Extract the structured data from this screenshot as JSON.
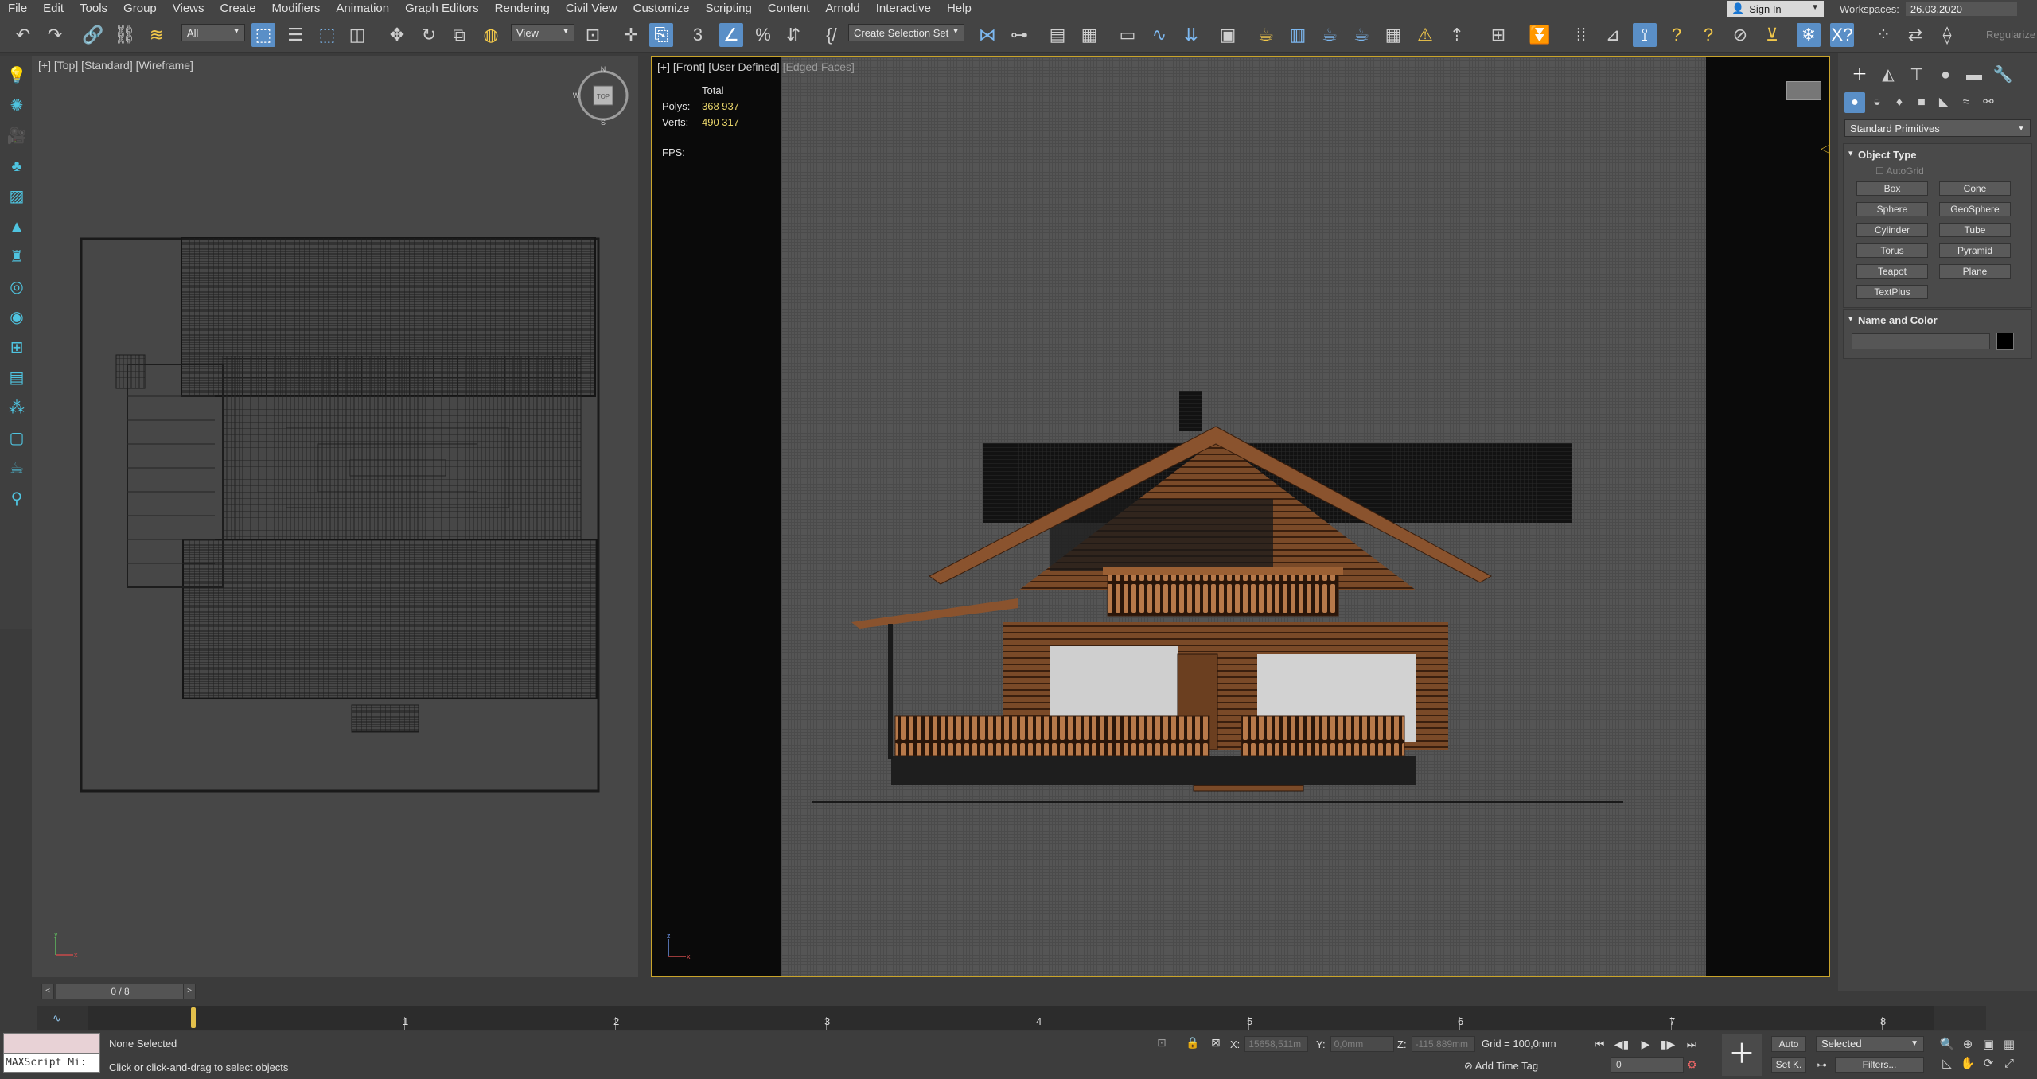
{
  "menu": [
    "File",
    "Edit",
    "Tools",
    "Group",
    "Views",
    "Create",
    "Modifiers",
    "Animation",
    "Graph Editors",
    "Rendering",
    "Civil View",
    "Customize",
    "Scripting",
    "Content",
    "Arnold",
    "Interactive",
    "Help"
  ],
  "account": {
    "sign_in": "Sign In",
    "workspaces_label": "Workspaces:",
    "workspace_value": "26.03.2020"
  },
  "toolbar": {
    "filter_value": "All",
    "ref_coord_value": "View",
    "selection_set_placeholder": "Create Selection Set",
    "regularize": "Regularize"
  },
  "viewports": {
    "top": {
      "label_plus": "[+]",
      "label_view": "[Top]",
      "label_standard": "[Standard]",
      "label_shading": "[Wireframe]",
      "viewcube_face": "TOP",
      "compass_n": "N",
      "compass_s": "S",
      "compass_w": "W",
      "axis_y": "y",
      "axis_x": "x"
    },
    "front": {
      "label_plus": "[+]",
      "label_view": "[Front]",
      "label_standard": "[User Defined]",
      "label_shading": "[Edged Faces]",
      "axis_z": "z",
      "axis_x": "x"
    }
  },
  "stats": {
    "header": "Total",
    "polys_label": "Polys:",
    "polys_value": "368 937",
    "verts_label": "Verts:",
    "verts_value": "490 317",
    "fps_label": "FPS:"
  },
  "command_panel": {
    "category": "Standard Primitives",
    "object_type_title": "Object Type",
    "autogrid": "AutoGrid",
    "objects": [
      "Box",
      "Cone",
      "Sphere",
      "GeoSphere",
      "Cylinder",
      "Tube",
      "Torus",
      "Pyramid",
      "Teapot",
      "Plane",
      "TextPlus"
    ],
    "name_color_title": "Name and Color",
    "color": "#000000"
  },
  "timeline": {
    "slider": "0 / 8",
    "prev": "<",
    "next": ">",
    "ticks": [
      "1",
      "2",
      "3",
      "4",
      "5",
      "6",
      "7",
      "8"
    ]
  },
  "status": {
    "maxscript": "MAXScript Mi:",
    "selection": "None Selected",
    "hint": "Click or click-and-drag to select objects",
    "x_label": "X:",
    "x_value": "15658,511m",
    "y_label": "Y:",
    "y_value": "0,0mm",
    "z_label": "Z:",
    "z_value": "-115,889mm",
    "grid": "Grid = 100,0mm",
    "add_time_tag": "Add Time Tag",
    "frame_value": "0",
    "auto_key": "Auto",
    "set_key": "Set K.",
    "key_filter_value": "Selected",
    "filters": "Filters..."
  },
  "colors": {
    "accent_blue": "#5a8fc7",
    "viewport_border": "#c9a42b",
    "stats_value": "#e8d46a"
  }
}
